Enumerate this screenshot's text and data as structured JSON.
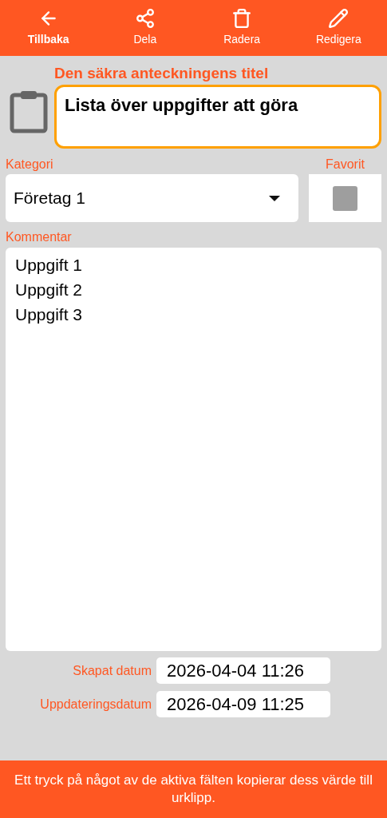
{
  "toolbar": [
    {
      "kind": "back",
      "label": "Tillbaka",
      "selected": true
    },
    {
      "kind": "share",
      "label": "Dela",
      "selected": false
    },
    {
      "kind": "delete",
      "label": "Radera",
      "selected": false
    },
    {
      "kind": "edit",
      "label": "Redigera",
      "selected": false
    }
  ],
  "title_label": "Den säkra anteckningens titel",
  "title_value": "Lista över uppgifter att göra",
  "category": {
    "label": "Kategori",
    "value": "Företag 1"
  },
  "favorite": {
    "label": "Favorit",
    "checked": false
  },
  "comment": {
    "label": "Kommentar",
    "lines": [
      "Uppgift 1",
      "Uppgift 2",
      "Uppgift 3"
    ]
  },
  "dates": [
    {
      "label": "Skapat datum",
      "value": "2026-04-04 11:26"
    },
    {
      "label": "Uppdateringsdatum",
      "value": "2026-04-09 11:25"
    }
  ],
  "footer": "Ett tryck på något av de aktiva fälten kopierar dess värde till urklipp."
}
